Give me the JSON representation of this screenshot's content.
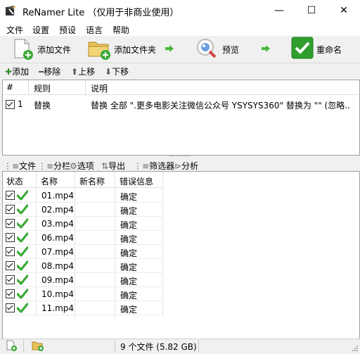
{
  "window": {
    "title": "ReNamer Lite （仅用于非商业使用）",
    "minimize": "—",
    "maximize": "☐",
    "close": "✕"
  },
  "menu": [
    "文件",
    "设置",
    "预设",
    "语言",
    "帮助"
  ],
  "toolbar": {
    "add_files": "添加文件",
    "add_folder": "添加文件夹",
    "preview": "预览",
    "rename": "重命名"
  },
  "actions": {
    "add": "添加",
    "remove": "移除",
    "up": "上移",
    "down": "下移"
  },
  "rules": {
    "headers": [
      "#",
      "规则",
      "说明"
    ],
    "rows": [
      {
        "num": "1",
        "name": "替换",
        "desc": "替换 全部 \".更多电影关注微信公众号 YSYSYS360\" 替换为 \"\" (忽略..."
      }
    ]
  },
  "file_tabs": [
    "文件",
    "分栏",
    "选项",
    "导出",
    "筛选器",
    "分析"
  ],
  "files": {
    "headers": [
      "状态",
      "名称",
      "新名称",
      "错误信息"
    ],
    "rows": [
      {
        "name": "01.mp4",
        "new_name": "",
        "error": "确定"
      },
      {
        "name": "02.mp4",
        "new_name": "",
        "error": "确定"
      },
      {
        "name": "03.mp4",
        "new_name": "",
        "error": "确定"
      },
      {
        "name": "06.mp4",
        "new_name": "",
        "error": "确定"
      },
      {
        "name": "07.mp4",
        "new_name": "",
        "error": "确定"
      },
      {
        "name": "08.mp4",
        "new_name": "",
        "error": "确定"
      },
      {
        "name": "09.mp4",
        "new_name": "",
        "error": "确定"
      },
      {
        "name": "10.mp4",
        "new_name": "",
        "error": "确定"
      },
      {
        "name": "11.mp4",
        "new_name": "",
        "error": "确定"
      }
    ]
  },
  "status": {
    "summary": "9 个文件 (5.82 GB)"
  },
  "colors": {
    "check_green": "#3aaa35",
    "arrow_green": "#48b83a",
    "rename_green": "#2f9e2c"
  }
}
